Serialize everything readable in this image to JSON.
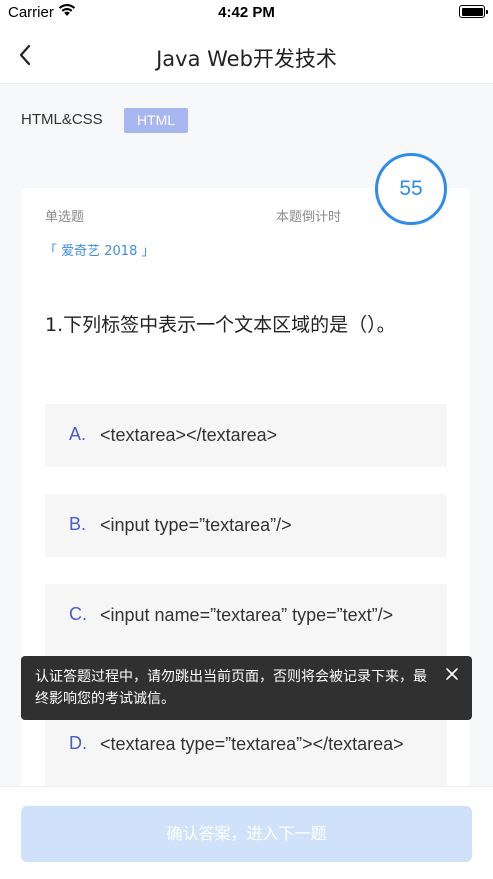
{
  "status_bar": {
    "carrier": "Carrier",
    "time": "4:42 PM"
  },
  "nav": {
    "title": "Java Web开发技术"
  },
  "tags": {
    "category": "HTML&CSS",
    "badge": "HTML"
  },
  "question_card": {
    "type": "单选题",
    "countdown_label": "本题倒计时",
    "timer_value": "55",
    "source": "「 爱奇艺 2018 」",
    "question": "1.下列标签中表示一个文本区域的是（）。",
    "options": [
      {
        "letter": "A.",
        "text": "<textarea></textarea>"
      },
      {
        "letter": "B.",
        "text": "<input type=”textarea”/>"
      },
      {
        "letter": "C.",
        "text": "<input name=”textarea” type=”text”/>"
      },
      {
        "letter": "D.",
        "text": "<textarea type=”textarea”></textarea>"
      }
    ]
  },
  "toast": {
    "message": "认证答题过程中，请勿跳出当前页面，否则将会被记录下来，最终影响您的考试诚信。"
  },
  "footer": {
    "confirm_label": "确认答案，进入下一题"
  },
  "colors": {
    "accent": "#2f8cee",
    "badge_bg": "#a8b7f2",
    "option_letter": "#4a5cc7",
    "button_disabled": "#cfe2fa"
  }
}
